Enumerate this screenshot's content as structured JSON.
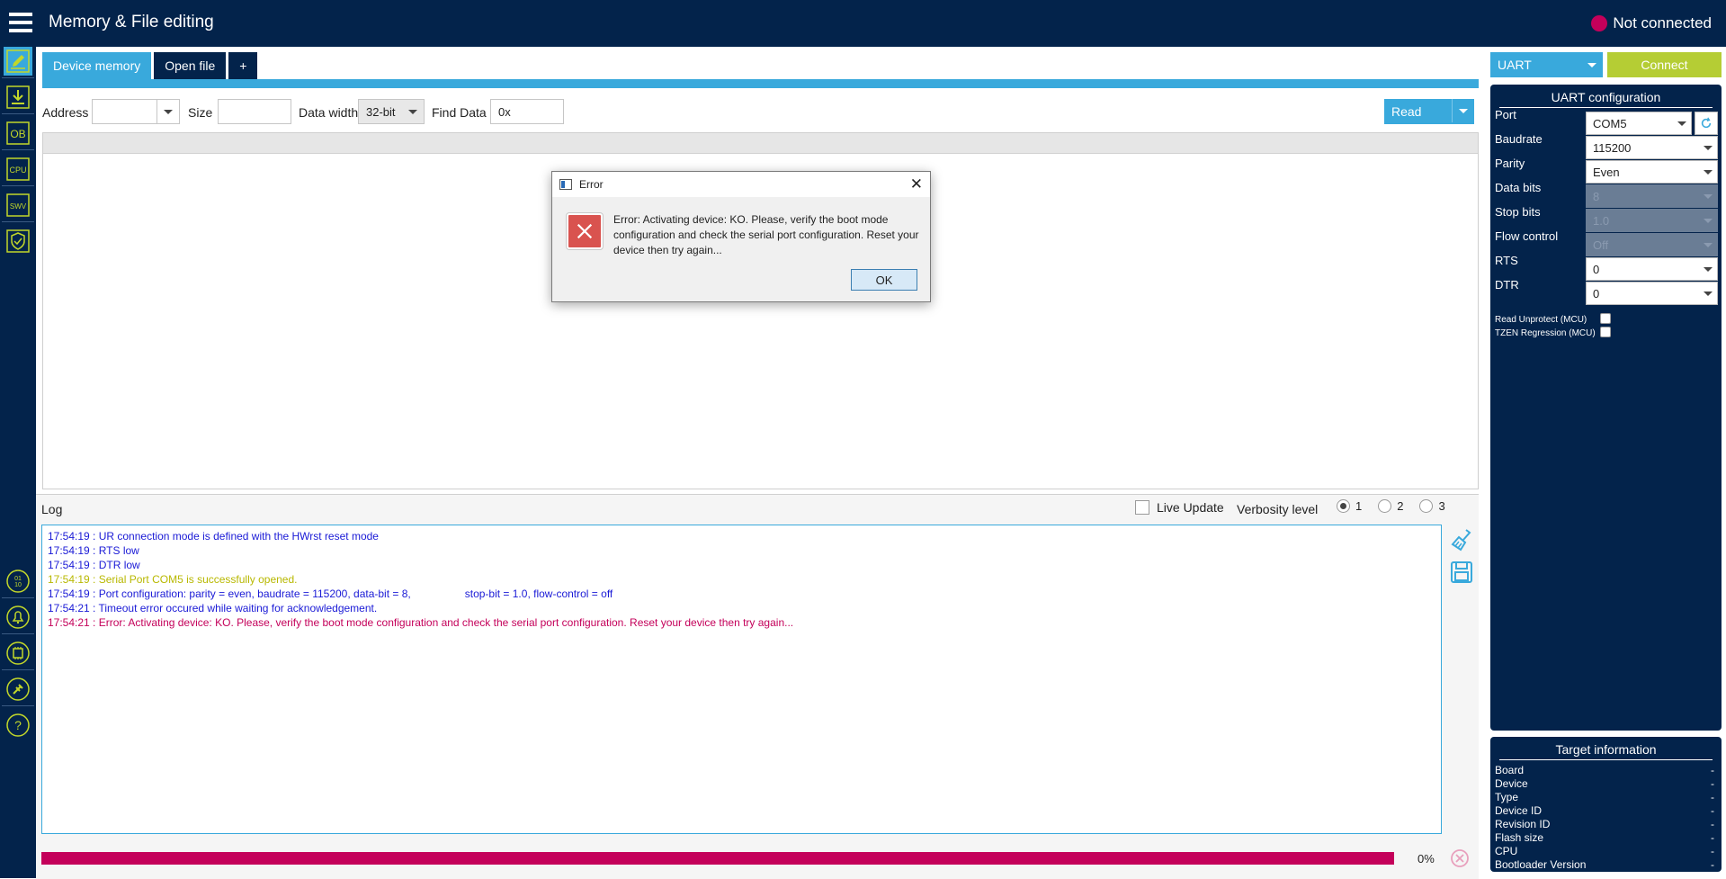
{
  "app": {
    "title": "Memory & File editing",
    "connection_status": "Not connected"
  },
  "sidebar": {
    "items": [
      {
        "name": "memory-edit",
        "icon": "pencil-icon"
      },
      {
        "name": "programming",
        "icon": "download-icon"
      },
      {
        "name": "option-bytes",
        "icon": "ob-icon",
        "text": "OB"
      },
      {
        "name": "cpu",
        "icon": "cpu-icon",
        "text": "CPU"
      },
      {
        "name": "swv",
        "icon": "swv-icon",
        "text": "SWV"
      },
      {
        "name": "security",
        "icon": "shield-icon"
      },
      {
        "name": "binary",
        "icon": "binary-icon"
      },
      {
        "name": "bell",
        "icon": "bell-icon"
      },
      {
        "name": "chip",
        "icon": "chip-icon"
      },
      {
        "name": "plugin",
        "icon": "plugin-icon"
      },
      {
        "name": "help",
        "icon": "help-icon",
        "text": "?"
      }
    ]
  },
  "tabs": {
    "device_memory": "Device memory",
    "open_file": "Open file",
    "add": "+"
  },
  "toolbar": {
    "address_label": "Address",
    "address_value": "",
    "size_label": "Size",
    "size_value": "",
    "data_width_label": "Data width",
    "data_width_value": "32-bit",
    "find_label": "Find Data",
    "find_value": "0x",
    "read_label": "Read"
  },
  "log": {
    "title": "Log",
    "live_update_label": "Live Update",
    "verbosity_label": "Verbosity level",
    "verbosity_options": [
      "1",
      "2",
      "3"
    ],
    "verbosity_selected": "1",
    "lines": [
      {
        "text": "17:54:19 : UR connection mode is defined with the HWrst reset mode",
        "color": "#1a1ad6"
      },
      {
        "text": "17:54:19 : RTS low",
        "color": "#1a1ad6"
      },
      {
        "text": "17:54:19 : DTR low",
        "color": "#1a1ad6"
      },
      {
        "text": "17:54:19 : Serial Port COM5 is successfully opened.",
        "color": "#b8b800"
      },
      {
        "text": "17:54:19 : Port configuration: parity = even, baudrate = 115200, data-bit = 8,                  stop-bit = 1.0, flow-control = off",
        "color": "#1a1ad6"
      },
      {
        "text": "17:54:21 : Timeout error occured while waiting for acknowledgement.",
        "color": "#1a1ad6"
      },
      {
        "text": "17:54:21 : Error: Activating device: KO. Please, verify the boot mode configuration and check the serial port configuration. Reset your device then try again...",
        "color": "#c4005a"
      }
    ],
    "progress_percent": "0%",
    "progress_value": 1.0
  },
  "connection": {
    "interface": "UART",
    "connect_label": "Connect",
    "config_title": "UART configuration",
    "fields": [
      {
        "label": "Port",
        "value": "COM5",
        "enabled": true
      },
      {
        "label": "Baudrate",
        "value": "115200",
        "enabled": true
      },
      {
        "label": "Parity",
        "value": "Even",
        "enabled": true
      },
      {
        "label": "Data bits",
        "value": "8",
        "enabled": false
      },
      {
        "label": "Stop bits",
        "value": "1.0",
        "enabled": false
      },
      {
        "label": "Flow control",
        "value": "Off",
        "enabled": false
      },
      {
        "label": "RTS",
        "value": "0",
        "enabled": true
      },
      {
        "label": "DTR",
        "value": "0",
        "enabled": true
      }
    ],
    "checks": [
      {
        "label": "Read Unprotect (MCU)",
        "checked": false
      },
      {
        "label": "TZEN Regression (MCU)",
        "checked": false
      }
    ]
  },
  "target_info": {
    "title": "Target information",
    "rows": [
      {
        "label": "Board",
        "value": "-"
      },
      {
        "label": "Device",
        "value": "-"
      },
      {
        "label": "Type",
        "value": "-"
      },
      {
        "label": "Device ID",
        "value": "-"
      },
      {
        "label": "Revision ID",
        "value": "-"
      },
      {
        "label": "Flash size",
        "value": "-"
      },
      {
        "label": "CPU",
        "value": "-"
      },
      {
        "label": "Bootloader Version",
        "value": "-"
      }
    ]
  },
  "dialog": {
    "title": "Error",
    "message": "Error: Activating device: KO. Please, verify the boot mode configuration and check the serial port configuration. Reset your device then try again...",
    "ok_label": "OK"
  },
  "colors": {
    "navy": "#03234b",
    "accent_blue": "#39a9dc",
    "connect_green": "#b5cd34",
    "status_magenta": "#c4005a",
    "icon_green": "#c2d72a"
  }
}
